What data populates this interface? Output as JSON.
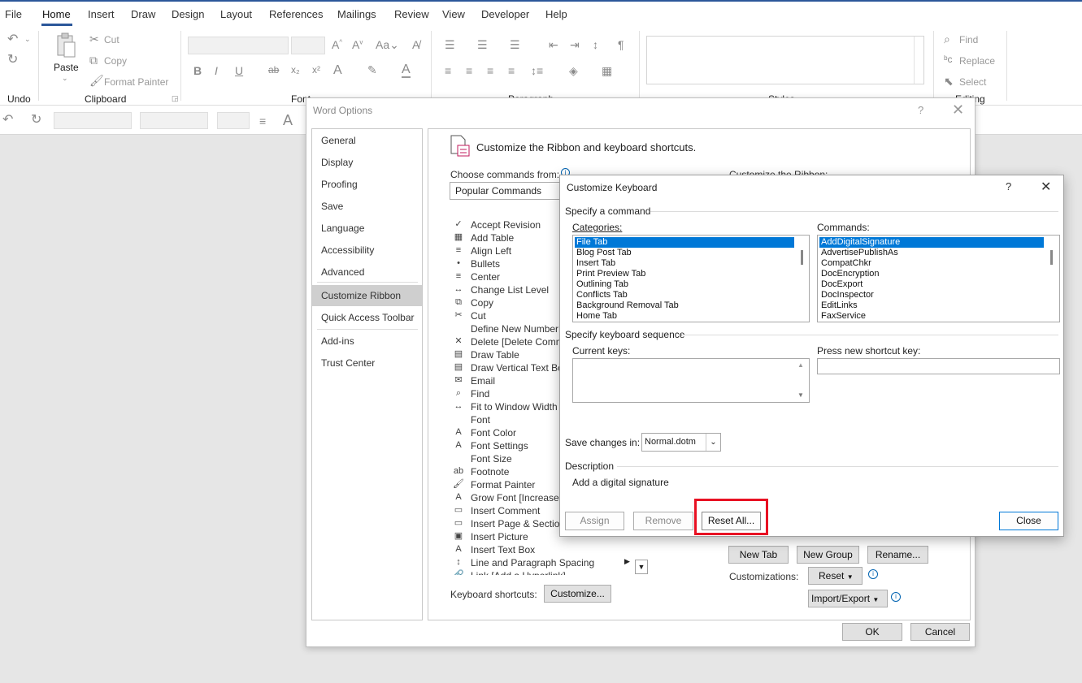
{
  "menu": {
    "tabs": [
      "File",
      "Home",
      "Insert",
      "Draw",
      "Design",
      "Layout",
      "References",
      "Mailings",
      "Review",
      "View",
      "Developer",
      "Help"
    ],
    "active": "Home"
  },
  "ribbon": {
    "undo_label": "Undo",
    "clipboard_label": "Clipboard",
    "paste_label": "Paste",
    "cut_label": "Cut",
    "copy_label": "Copy",
    "format_painter_label": "Format Painter",
    "font_label": "Font",
    "paragraph_label": "Paragraph",
    "styles_label": "Styles",
    "editing_label": "Editing",
    "find_label": "Find",
    "replace_label": "Replace",
    "select_label": "Select"
  },
  "word_options": {
    "title": "Word Options",
    "help": "?",
    "nav": [
      "General",
      "Display",
      "Proofing",
      "Save",
      "Language",
      "Accessibility",
      "Advanced",
      "Customize Ribbon",
      "Quick Access Toolbar",
      "Add-ins",
      "Trust Center"
    ],
    "nav_active": "Customize Ribbon",
    "heading": "Customize the Ribbon and keyboard shortcuts.",
    "choose_label": "Choose commands from:",
    "choose_value": "Popular Commands",
    "customize_ribbon_label": "Customize the Ribbon:",
    "commands": [
      "Accept Revision",
      "Add Table",
      "Align Left",
      "Bullets",
      "Center",
      "Change List Level",
      "Copy",
      "Cut",
      "Define New Number",
      "Delete [Delete Comm",
      "Draw Table",
      "Draw Vertical Text Box",
      "Email",
      "Find",
      "Fit to Window Width",
      "Font",
      "Font Color",
      "Font Settings",
      "Font Size",
      "Footnote",
      "Format Painter",
      "Grow Font [Increase F",
      "Insert Comment",
      "Insert Page & Section",
      "Insert Picture",
      "Insert Text Box",
      "Line and Paragraph Spacing",
      "Link [Add a Hyperlink]"
    ],
    "keyboard_shortcuts_label": "Keyboard shortcuts:",
    "customize_btn": "Customize...",
    "new_tab_btn": "New Tab",
    "new_group_btn": "New Group",
    "rename_btn": "Rename...",
    "customizations_label": "Customizations:",
    "reset_btn": "Reset",
    "import_export_btn": "Import/Export",
    "ok_btn": "OK",
    "cancel_btn": "Cancel"
  },
  "customize_keyboard": {
    "title": "Customize Keyboard",
    "help": "?",
    "specify_command": "Specify a command",
    "categories_label": "Categories:",
    "categories": [
      "File Tab",
      "Blog Post Tab",
      "Insert Tab",
      "Print Preview Tab",
      "Outlining Tab",
      "Conflicts Tab",
      "Background Removal Tab",
      "Home Tab"
    ],
    "categories_selected": "File Tab",
    "commands_label": "Commands:",
    "commands": [
      "AddDigitalSignature",
      "AdvertisePublishAs",
      "CompatChkr",
      "DocEncryption",
      "DocExport",
      "DocInspector",
      "EditLinks",
      "FaxService"
    ],
    "commands_selected": "AddDigitalSignature",
    "specify_sequence": "Specify keyboard sequence",
    "current_keys_label": "Current keys:",
    "press_new_label": "Press new shortcut key:",
    "save_changes_label": "Save changes in:",
    "save_changes_value": "Normal.dotm",
    "description_label": "Description",
    "description_text": "Add a digital signature",
    "assign_btn": "Assign",
    "remove_btn": "Remove",
    "reset_all_btn": "Reset All...",
    "close_btn": "Close"
  },
  "colors": {
    "accent": "#2b579a",
    "selection": "#0078d7",
    "highlight_box": "#e81123",
    "info_icon": "#0063b1"
  }
}
